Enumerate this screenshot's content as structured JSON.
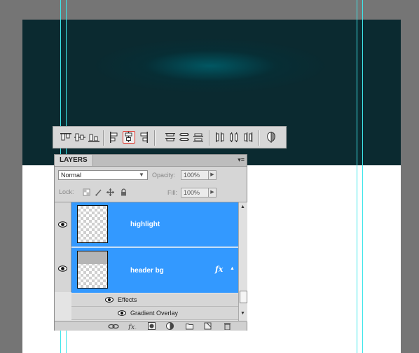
{
  "layers_panel": {
    "tab_label": "LAYERS",
    "menu_glyph": "▾≡",
    "blend_mode": "Normal",
    "opacity_label": "Opacity:",
    "opacity_value": "100%",
    "lock_label": "Lock:",
    "fill_label": "Fill:",
    "fill_value": "100%",
    "layers": [
      {
        "name": "highlight",
        "selected": true,
        "visible": true
      },
      {
        "name": "header bg",
        "selected": true,
        "visible": true,
        "fx": "fx"
      }
    ],
    "effects_label": "Effects",
    "effect_items": [
      "Gradient Overlay"
    ]
  },
  "align_toolbar": {
    "selected_button": "align-vertical-centers"
  },
  "colors": {
    "header_dark": "#0b2a30",
    "header_glow": "#005c68",
    "selection_blue": "#3399ff",
    "guide_cyan": "#3ee6ea",
    "pasteboard": "#757575"
  }
}
